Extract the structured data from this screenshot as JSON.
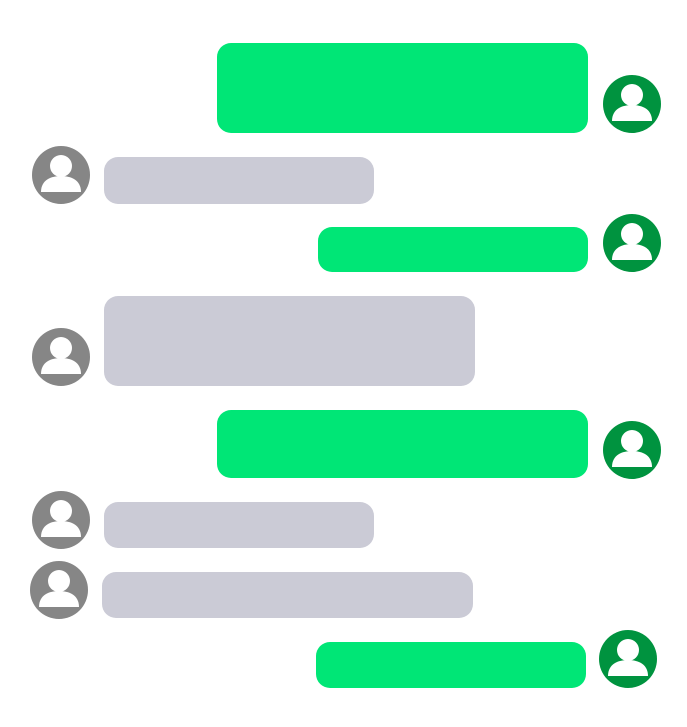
{
  "colors": {
    "sent_bubble": "#00e676",
    "received_bubble": "#cbcbd6",
    "sent_avatar": "#00933f",
    "received_avatar": "#868686",
    "background": "#ffffff"
  },
  "messages": [
    {
      "sender": "me",
      "text": "",
      "avatar_icon": "user-avatar-icon"
    },
    {
      "sender": "other",
      "text": "",
      "avatar_icon": "user-avatar-icon"
    },
    {
      "sender": "me",
      "text": "",
      "avatar_icon": "user-avatar-icon"
    },
    {
      "sender": "other",
      "text": "",
      "avatar_icon": "user-avatar-icon"
    },
    {
      "sender": "me",
      "text": "",
      "avatar_icon": "user-avatar-icon"
    },
    {
      "sender": "other",
      "text": "",
      "avatar_icon": "user-avatar-icon"
    },
    {
      "sender": "other",
      "text": "",
      "avatar_icon": "user-avatar-icon"
    },
    {
      "sender": "me",
      "text": "",
      "avatar_icon": "user-avatar-icon"
    }
  ]
}
